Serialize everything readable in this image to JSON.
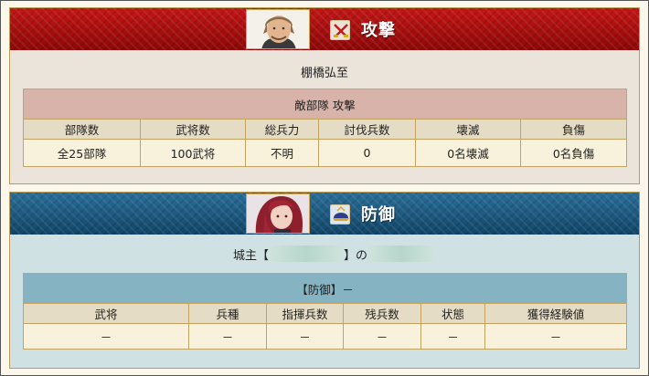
{
  "attack": {
    "title": "攻撃",
    "commander": "棚橋弘至",
    "table_caption": "敵部隊 攻撃",
    "columns": [
      "部隊数",
      "武将数",
      "総兵力",
      "討伐兵数",
      "壊滅",
      "負傷"
    ],
    "row": [
      "全25部隊",
      "100武将",
      "不明",
      "0",
      "0名壊滅",
      "0名負傷"
    ],
    "banner_color": "#b20f0f"
  },
  "defense": {
    "title": "防御",
    "commander_prefix": "城主【",
    "commander_suffix": "】の",
    "table_caption": "【防御】－",
    "columns": [
      "武将",
      "兵種",
      "指揮兵数",
      "残兵数",
      "状態",
      "獲得経験値"
    ],
    "row": [
      "－",
      "－",
      "－",
      "－",
      "－",
      "－"
    ],
    "banner_color": "#1b5b86"
  },
  "icons": {
    "attack_badge": "crossed-swords-icon",
    "defense_badge": "helmet-icon"
  }
}
